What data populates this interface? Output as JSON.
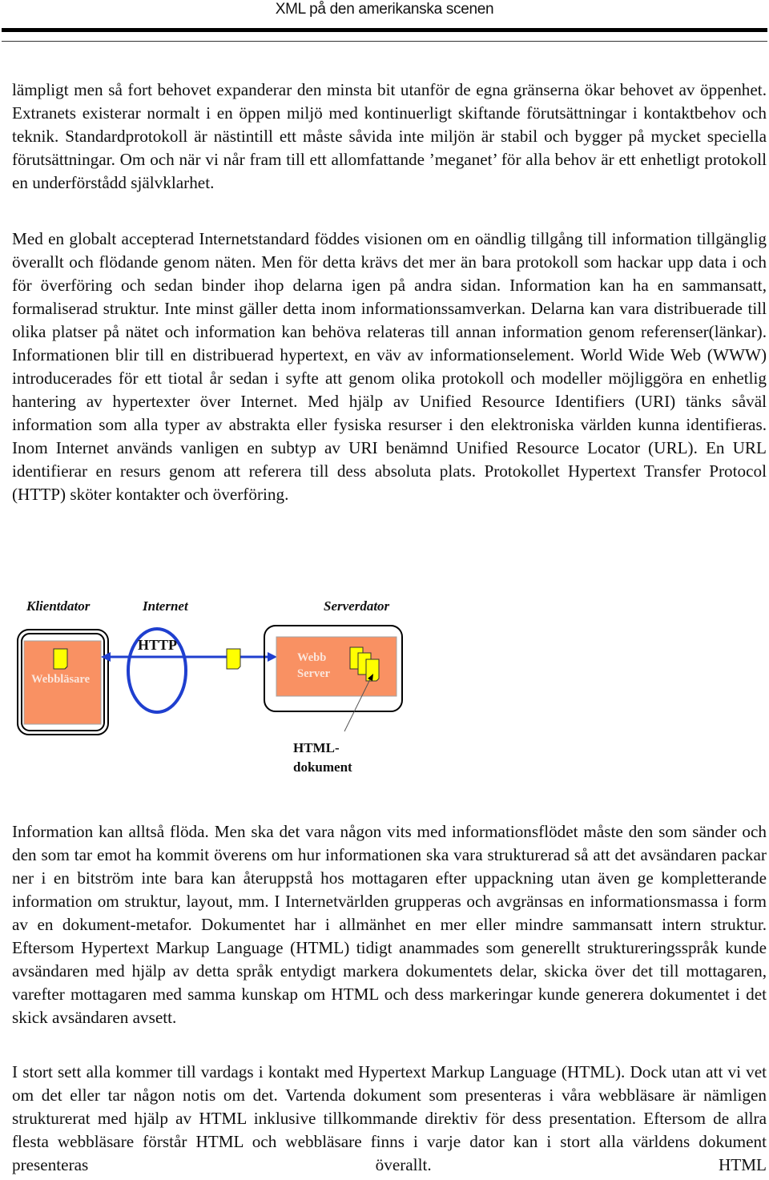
{
  "header": {
    "title": "XML på den amerikanska scenen"
  },
  "paragraphs": {
    "p1": "lämpligt men så fort behovet expanderar den minsta bit utanför de egna gränserna ökar behovet av öppenhet. Extranets existerar normalt i en öppen miljö med kontinuerligt skiftande förutsättningar i kontaktbehov och teknik. Standardprotokoll är nästintill ett måste såvida inte miljön är stabil och bygger på mycket speciella förutsättningar. Om och när vi når fram till ett allomfattande ’meganet’ för alla behov är ett enhetligt protokoll en underförstådd självklarhet.",
    "p2": "Med en globalt accepterad Internetstandard föddes visionen om en oändlig tillgång till information tillgänglig överallt och flödande genom näten. Men för detta krävs det mer än bara protokoll som hackar upp data i och för överföring och sedan binder ihop delarna igen på andra sidan. Information kan ha en sammansatt, formaliserad struktur. Inte minst gäller detta inom informationssamverkan. Delarna kan vara distribuerade till olika platser på nätet och information kan behöva relateras till annan information genom referenser(länkar). Informationen blir till en distribuerad hypertext, en väv av informationselement. World Wide Web (WWW) introducerades för ett tiotal år sedan i syfte att genom olika protokoll och modeller möjliggöra en enhetlig hantering av hypertexter över Internet. Med hjälp av Unified Resource Identifiers (URI) tänks såväl information som alla typer av abstrakta eller fysiska resurser i den elektroniska världen kunna identifieras. Inom Internet används vanligen en subtyp av URI benämnd Unified Resource Locator (URL). En URL identifierar en resurs genom att referera till dess absoluta plats. Protokollet Hypertext Transfer Protocol (HTTP) sköter kontakter och överföring.",
    "p3": "Information kan alltså flöda. Men ska det vara någon vits med informationsflödet måste den som sänder och den som tar emot ha kommit överens om hur informationen ska vara strukturerad så att det avsändaren packar ner i en bitström inte bara kan återuppstå hos mottagaren efter uppackning utan även ge kompletterande information om struktur, layout, mm. I Internetvärlden grupperas och avgränsas en informationsmassa i form av en dokument-metafor. Dokumentet har i allmänhet en mer eller mindre sammansatt intern struktur. Eftersom Hypertext Markup Language (HTML) tidigt anammades som generellt struktureringsspråk kunde avsändaren med hjälp av detta språk entydigt markera dokumentets delar, skicka över det till mottagaren, varefter mottagaren med samma kunskap om HTML och dess markeringar kunde generera dokumentet i det skick avsändaren avsett.",
    "p4": "I stort sett alla kommer till vardags i kontakt med Hypertext Markup Language (HTML). Dock utan att vi vet om det eller tar någon notis om det. Vartenda dokument som presenteras i våra webbläsare är nämligen strukturerat med hjälp av HTML inklusive tillkommande direktiv för dess presentation. Eftersom de allra flesta webbläsare förstår HTML och webbläsare finns i varje dator kan i stort alla världens dokument presenteras överallt. HTML"
  },
  "diagram": {
    "labels": {
      "client": "Klientdator",
      "internet": "Internet",
      "server": "Serverdator"
    },
    "protocol": "HTTP",
    "browser_label": "Webbläsare",
    "server_label_line1": "Webb",
    "server_label_line2": "Server",
    "callout_line1": "HTML-",
    "callout_line2": "dokument",
    "icons": [
      "document-icon",
      "document-icon",
      "document-stack-icon"
    ],
    "colors": {
      "box_fill": "#f99163",
      "link_blue": "#1f3fcf",
      "doc_yellow": "#ffff00"
    }
  }
}
